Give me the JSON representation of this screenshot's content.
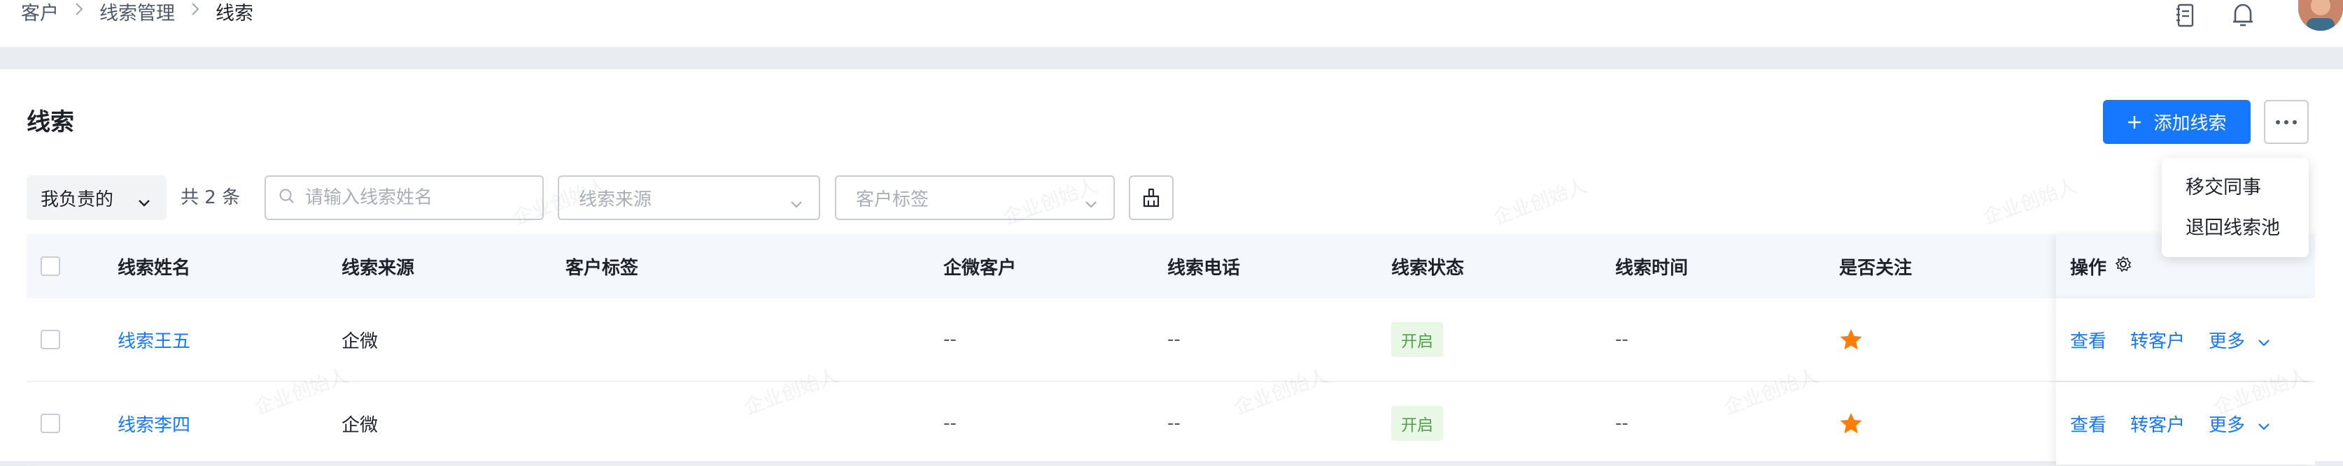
{
  "breadcrumb": {
    "items": [
      "客户",
      "线索管理",
      "线索"
    ]
  },
  "page": {
    "title": "线索"
  },
  "actions": {
    "add_label": "添加线索",
    "more_menu": [
      "移交同事",
      "退回线索池"
    ]
  },
  "filters": {
    "scope": "我负责的",
    "total": "共 2 条",
    "search_placeholder": "请输入线索姓名",
    "source_placeholder": "线索来源",
    "tags_placeholder": "客户标签"
  },
  "table": {
    "columns": [
      "线索姓名",
      "线索来源",
      "客户标签",
      "企微客户",
      "线索电话",
      "线索状态",
      "线索时间",
      "是否关注",
      "操作"
    ],
    "rows": [
      {
        "name": "线索王五",
        "source": "企微",
        "tags": "",
        "wecom": "--",
        "phone": "--",
        "status": "开启",
        "time": "--",
        "followed": true
      },
      {
        "name": "线索李四",
        "source": "企微",
        "tags": "",
        "wecom": "--",
        "phone": "--",
        "status": "开启",
        "time": "--",
        "followed": true
      }
    ],
    "row_actions": {
      "view": "查看",
      "convert": "转客户",
      "more": "更多"
    }
  },
  "watermark": "企业创始人",
  "colors": {
    "primary": "#1677ff",
    "star": "#ff7d00",
    "tag_bg": "#e8f7e6",
    "tag_text": "#52a147"
  },
  "icons": [
    "chevron-right-icon",
    "notes-icon",
    "bell-icon",
    "search-icon",
    "chevron-down-icon",
    "broom-icon",
    "gear-icon",
    "star-icon",
    "plus-icon",
    "more-icon"
  ]
}
